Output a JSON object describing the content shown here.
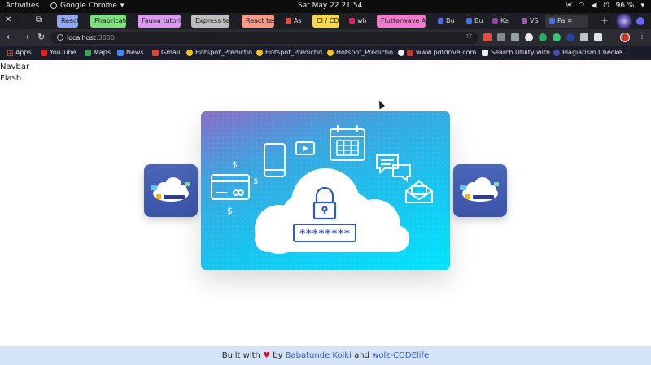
{
  "topbar": {
    "activities": "Activities",
    "app_name": "Google Chrome",
    "clock": "Sat May 22  21:54",
    "battery": "96 %"
  },
  "tabs": [
    {
      "label": "React",
      "color": "#8fa8f0"
    },
    {
      "label": "Phabricator",
      "color": "#7fe07f"
    },
    {
      "label": "Fauna tutorial",
      "color": "#d99af0"
    },
    {
      "label": "Express test",
      "color": "#bdbdbd"
    },
    {
      "label": "React test",
      "color": "#f59a8a"
    },
    {
      "label": "As",
      "color": ""
    },
    {
      "label": "CI / CD",
      "color": "#f5d94a"
    },
    {
      "label": "wh",
      "color": ""
    },
    {
      "label": "Flutterwave API",
      "color": "#f27bd0"
    },
    {
      "label": "Bu",
      "color": ""
    },
    {
      "label": "Bu",
      "color": ""
    },
    {
      "label": "Ke",
      "color": ""
    },
    {
      "label": "VS",
      "color": ""
    },
    {
      "label": "Pa",
      "color": ""
    }
  ],
  "omnibox": {
    "host": "localhost",
    "port": ":3000"
  },
  "bookmarks": [
    {
      "label": "Apps"
    },
    {
      "label": "YouTube"
    },
    {
      "label": "Maps"
    },
    {
      "label": "News"
    },
    {
      "label": "Gmail"
    },
    {
      "label": "Hotspot_Predictio..."
    },
    {
      "label": "Hotspot_Predictid..."
    },
    {
      "label": "Hotspot_Predictio..."
    },
    {
      "label": "www.pdfdrive.com"
    },
    {
      "label": "Search Utility with..."
    },
    {
      "label": "Plagiarism Checke..."
    }
  ],
  "page": {
    "navbar_text": "Navbar",
    "flash_text": "Flash",
    "password_mask": "********"
  },
  "footer": {
    "built_with": "Built with",
    "by": "by",
    "author1": "Babatunde Koiki",
    "and": "and",
    "author2": "wolz-CODElife"
  },
  "colors": {
    "footer_bg": "#d5e3f6",
    "link": "#2f5bbf",
    "heart": "#d8132d"
  }
}
